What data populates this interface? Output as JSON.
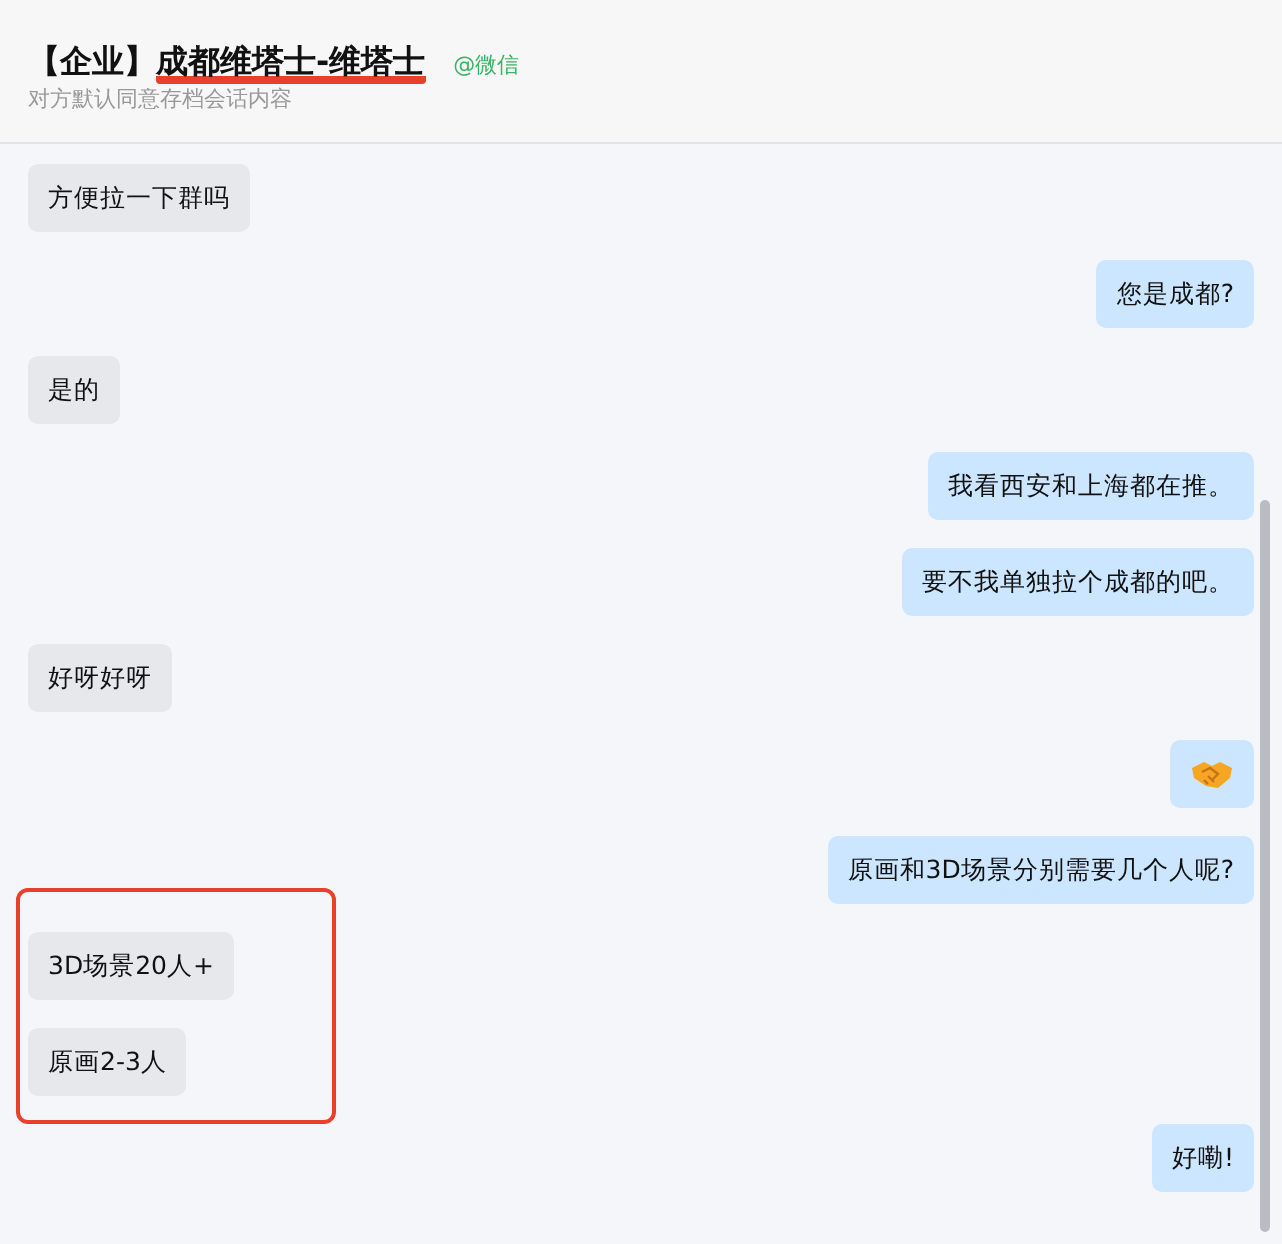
{
  "header": {
    "title_prefix": "【企业】",
    "title_name": "成都维塔士-维塔士",
    "name_underlined": true,
    "source": "@微信",
    "subtitle": "对方默认同意存档会话内容"
  },
  "messages": [
    {
      "outgoing": false,
      "kind": "text",
      "text": "方便拉一下群吗",
      "highlighted": false
    },
    {
      "outgoing": true,
      "kind": "text",
      "text": "您是成都?",
      "highlighted": false
    },
    {
      "outgoing": false,
      "kind": "text",
      "text": "是的",
      "highlighted": false
    },
    {
      "outgoing": true,
      "kind": "text",
      "text": "我看西安和上海都在推。",
      "highlighted": false
    },
    {
      "outgoing": true,
      "kind": "text",
      "text": "要不我单独拉个成都的吧。",
      "highlighted": false
    },
    {
      "outgoing": false,
      "kind": "text",
      "text": "好呀好呀",
      "highlighted": false
    },
    {
      "outgoing": true,
      "kind": "emoji",
      "highlighted": false
    },
    {
      "outgoing": true,
      "kind": "text",
      "text": "原画和3D场景分别需要几个人呢?",
      "highlighted": false
    },
    {
      "outgoing": false,
      "kind": "text",
      "text": "3D场景20人+",
      "highlighted": true
    },
    {
      "outgoing": false,
      "kind": "text",
      "text": "原画2-3人",
      "highlighted": true
    },
    {
      "outgoing": true,
      "kind": "text",
      "text": "好嘞!",
      "highlighted": false
    }
  ]
}
